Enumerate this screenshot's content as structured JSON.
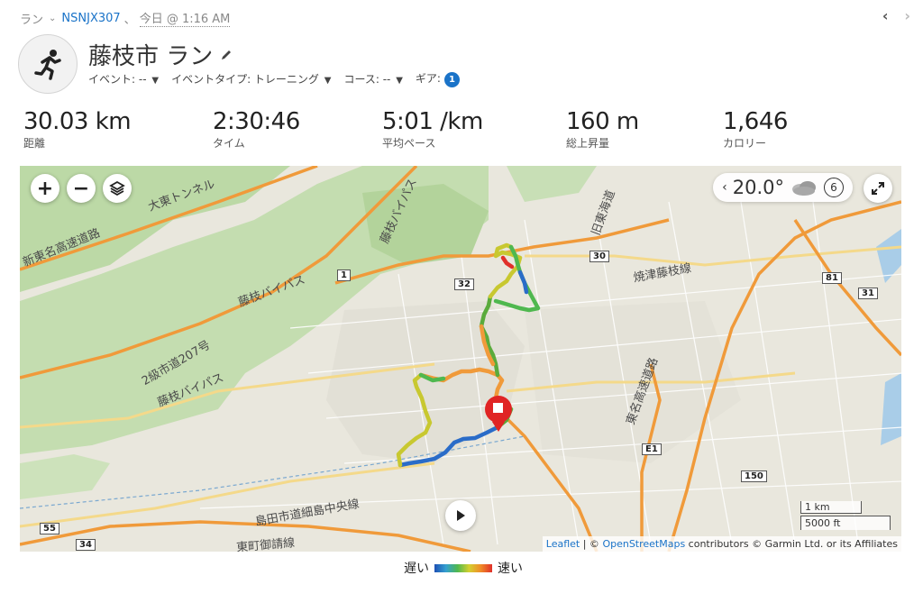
{
  "breadcrumb": {
    "activity_type": "ラン",
    "user": "NSNJX307",
    "sep": "、",
    "time": "今日 @ 1:16 AM"
  },
  "header": {
    "title": "藤枝市 ラン",
    "event_label": "イベント: --",
    "event_type_label": "イベントタイプ: トレーニング",
    "course_label": "コース: --",
    "gear_label": "ギア:",
    "gear_count": "1"
  },
  "stats": [
    {
      "value": "30.03 km",
      "label": "距離"
    },
    {
      "value": "2:30:46",
      "label": "タイム"
    },
    {
      "value": "5:01 /km",
      "label": "平均ペース"
    },
    {
      "value": "160 m",
      "label": "総上昇量"
    },
    {
      "value": "1,646",
      "label": "カロリー"
    }
  ],
  "map": {
    "temperature": "20.0°",
    "wind": "6",
    "scale_km": "1 km",
    "scale_ft": "5000 ft",
    "attribution_leaflet": "Leaflet",
    "attribution_sep": " | © ",
    "attribution_osm": "OpenStreetMaps",
    "attribution_rest": " contributors © Garmin Ltd. or its Affiliates",
    "labels": {
      "tunnel": "大東トンネル",
      "tomei": "新東名高速道路",
      "fujieda_bypass_1": "藤枝バイパス",
      "fujieda_bypass_2": "藤枝バイパス",
      "fujieda_bypass_3": "藤枝バイパス",
      "kyu_tokaido": "旧東海道",
      "route_381": "2級市道207号",
      "yaizu_line": "焼津藤枝線",
      "tomei_exp": "東名高速道路",
      "shimada": "島田市道細島中央線",
      "higashicho": "東町御請線"
    },
    "route_numbers": [
      "1",
      "32",
      "30",
      "81",
      "31",
      "34",
      "55",
      "150",
      "E1"
    ]
  },
  "legend": {
    "slow": "遅い",
    "fast": "速い"
  }
}
